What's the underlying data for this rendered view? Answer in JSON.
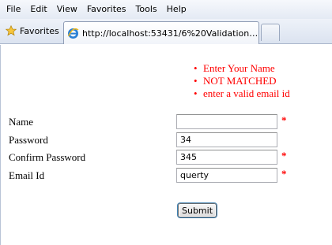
{
  "menu": {
    "items": [
      "File",
      "Edit",
      "View",
      "Favorites",
      "Tools",
      "Help"
    ]
  },
  "favorites_bar": {
    "favorites_label": "Favorites",
    "favorites_icon": "star-icon"
  },
  "tab": {
    "icon": "ie-icon",
    "title": "http://localhost:53431/6%20ValidationSummary/..."
  },
  "validation_summary": {
    "color": "#ff0000",
    "messages": [
      "Enter Your Name",
      "NOT MATCHED",
      "enter a valid email id"
    ]
  },
  "form": {
    "name": {
      "label": "Name",
      "value": "",
      "required_marker": "*"
    },
    "password": {
      "label": "Password",
      "value": "34"
    },
    "confirm_password": {
      "label": "Confirm Password",
      "value": "345",
      "required_marker": "*"
    },
    "email": {
      "label": "Email Id",
      "value": "querty",
      "required_marker": "*"
    },
    "submit_label": "Submit"
  }
}
